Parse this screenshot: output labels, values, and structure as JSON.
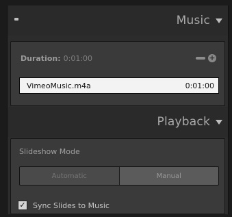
{
  "music_section": {
    "title": "Music",
    "duration_label": "Duration:",
    "duration_value": "0:01:00",
    "track_name": "VimeoMusic.m4a",
    "track_time": "0:01:00"
  },
  "playback_section": {
    "title": "Playback",
    "mode_label": "Slideshow Mode",
    "mode_options": [
      "Automatic",
      "Manual"
    ],
    "mode_selected": "Manual",
    "sync_checkbox_label": "Sync Slides to Music",
    "sync_checked": true
  },
  "icons": {
    "collapse": "collapse-icon",
    "disclosure": "disclosure-triangle-icon",
    "minus": "minus-icon",
    "plus": "plus-icon",
    "check": "checkmark-icon"
  }
}
